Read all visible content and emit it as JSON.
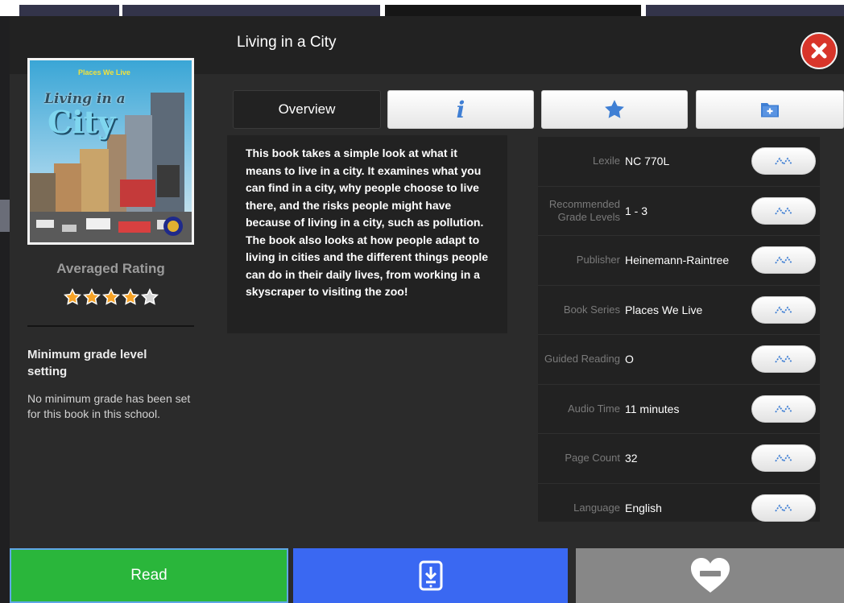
{
  "modal": {
    "title": "Living in a City",
    "close_icon": "close-x-icon",
    "accent_close": "#d8352a"
  },
  "cover": {
    "series_banner": "Places We Live",
    "title_line1": "Living in a",
    "title_line2": "City"
  },
  "rating": {
    "label": "Averaged Rating",
    "stars_filled": 4,
    "stars_total": 5,
    "star_color": "#f7a327"
  },
  "min_grade": {
    "title": "Minimum grade level setting",
    "text": "No minimum grade has been set for this book in this school."
  },
  "tabs": [
    {
      "label": "Overview",
      "active": true
    },
    {
      "icon": "info-icon",
      "active": false
    },
    {
      "icon": "star-icon",
      "active": false
    },
    {
      "icon": "folder-add-icon",
      "active": false
    }
  ],
  "overview": {
    "text": "This book takes a simple look at what it means to live in a city. It examines what you can find in a city, why people choose to live there, and the risks people might have because of living in a city, such as pollution. The book also looks at how people adapt to living in cities and the different things people can do in their daily lives, from working in a skyscraper to visiting the zoo!"
  },
  "details": [
    {
      "label": "Lexile",
      "value": "NC 770L",
      "action_icon": "similar-books-icon"
    },
    {
      "label": "Recommended Grade Levels",
      "value": "1 - 3",
      "action_icon": "similar-books-icon"
    },
    {
      "label": "Publisher",
      "value": "Heinemann-Raintree",
      "action_icon": "similar-books-icon"
    },
    {
      "label": "Book Series",
      "value": "Places We Live",
      "action_icon": "similar-books-icon"
    },
    {
      "label": "Guided Reading",
      "value": "O",
      "action_icon": "similar-books-icon"
    },
    {
      "label": "Audio Time",
      "value": "11 minutes",
      "action_icon": "similar-books-icon"
    },
    {
      "label": "Page Count",
      "value": "32",
      "action_icon": "similar-books-icon"
    },
    {
      "label": "Language",
      "value": "English",
      "action_icon": "similar-books-icon"
    }
  ],
  "bottom_bar": {
    "read_label": "Read",
    "download_icon": "download-tablet-icon",
    "favorite_icon": "heart-remove-icon",
    "colors": {
      "read": "#2ab63b",
      "download": "#3a68f2",
      "favorite": "#878787"
    }
  }
}
